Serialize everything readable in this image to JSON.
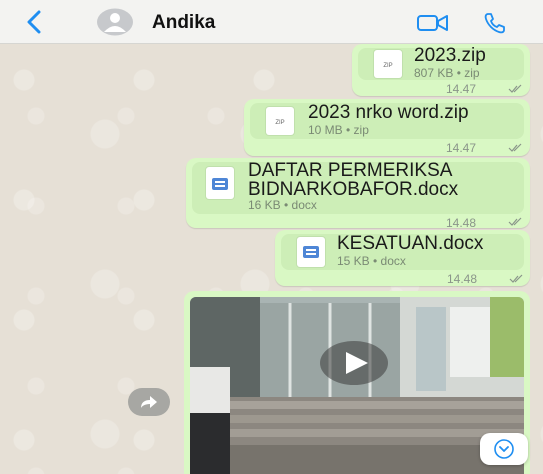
{
  "header": {
    "contact_name": "Andika",
    "back_icon": "chevron-left-icon",
    "video_icon": "video-camera-icon",
    "call_icon": "phone-icon",
    "accent_color": "#1f8ef1"
  },
  "messages": [
    {
      "file_name": "2023.zip",
      "icon_label": "ZIP",
      "meta": "807 KB • zip",
      "time": "14.47"
    },
    {
      "file_name": "2023 nrko word.zip",
      "icon_label": "ZIP",
      "meta": "10 MB • zip",
      "time": "14.47"
    },
    {
      "file_name_line1": "DAFTAR PERMERIKSA",
      "file_name_line2": "BIDNARKOBAFOR.docx",
      "meta": "16 KB • docx",
      "time": "14.48"
    },
    {
      "file_name": "KESATUAN.docx",
      "meta": "15 KB • docx",
      "time": "14.48"
    }
  ],
  "video": {
    "play_icon": "play-icon",
    "forward_icon": "forward-share-icon",
    "scroll_icon": "chevron-down-icon"
  },
  "colors": {
    "bubble": "#d9f8c4",
    "chat_bg": "#e6e0d6",
    "header_bg": "#f3f3f1"
  }
}
